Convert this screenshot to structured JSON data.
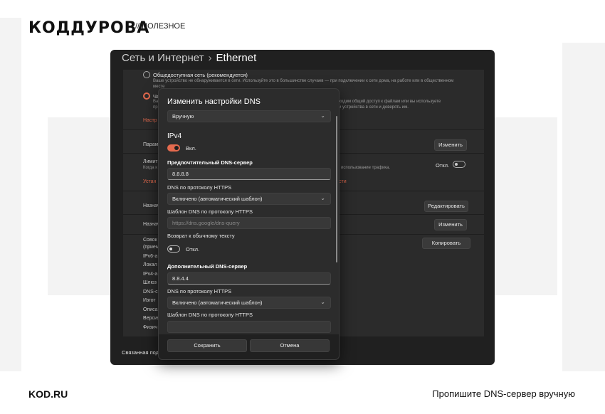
{
  "site": {
    "logo": "КОДДУРОВА",
    "section": "// ПОЛЕЗНОЕ",
    "domain": "KOD.RU",
    "caption": "Пропишите DNS-сервер вручную"
  },
  "breadcrumb": {
    "parent": "Сеть и Интернет",
    "separator": "›",
    "current": "Ethernet"
  },
  "background": {
    "public_title": "Общедоступная сеть (рекомендуется)",
    "public_desc": "Ваше устройство не обнаруживается в сети. Используйте это в большинстве случаев — при подключении к сети дома, на работе или в общественном",
    "public_desc2": "месте",
    "private_title": "Ча",
    "private_desc_l1": "Ва",
    "private_desc_r1": "ходим общий доступ к файлам или вы используете",
    "private_desc_l2": "пр",
    "private_desc_r2": "и устройства в сети и доверять им.",
    "configure_link": "Настр",
    "params": "Парам",
    "change1": "Изменить",
    "limit": "Лимит",
    "limit_desc": "Когда к",
    "limit_desc_r": "использование трафика.",
    "off": "Откл.",
    "set_link": "Устан",
    "set_link_r": "сти",
    "assign1": "Назнач",
    "edit": "Редактировать",
    "assign2": "Назнач",
    "change2": "Изменить",
    "props": [
      "Совок",
      "(прием",
      "IPv6-а",
      "Локал",
      "IPv4-а",
      "Шлюз",
      "DNS-с",
      "Изгот",
      "Описа",
      "Версия",
      "Физич"
    ],
    "copy": "Копировать",
    "related": "Связанная под"
  },
  "dialog": {
    "title": "Изменить настройки DNS",
    "mode": "Вручную",
    "ipv4_heading": "IPv4",
    "ipv4_toggle_label": "Вкл.",
    "preferred_label": "Предпочтительный DNS-сервер",
    "preferred_value": "8.8.8.8",
    "https_label": "DNS по протоколу HTTPS",
    "https_value": "Включено (автоматический шаблон)",
    "template_label": "Шаблон DNS по протоколу HTTPS",
    "template_placeholder": "https://dns.google/dns-query",
    "fallback_label": "Возврат к обычному тексту",
    "fallback_toggle_label": "Откл.",
    "alternate_label": "Дополнительный DNS-сервер",
    "alternate_value": "8.8.4.4",
    "https_label2": "DNS по протоколу HTTPS",
    "https_value2": "Включено (автоматический шаблон)",
    "template_label2": "Шаблон DNS по протоколу HTTPS",
    "save": "Сохранить",
    "cancel": "Отмена",
    "chevron": "⌄"
  },
  "colors": {
    "accent": "#e46a4e",
    "window_bg": "#202020",
    "panel_bg": "#2b2b2b"
  }
}
